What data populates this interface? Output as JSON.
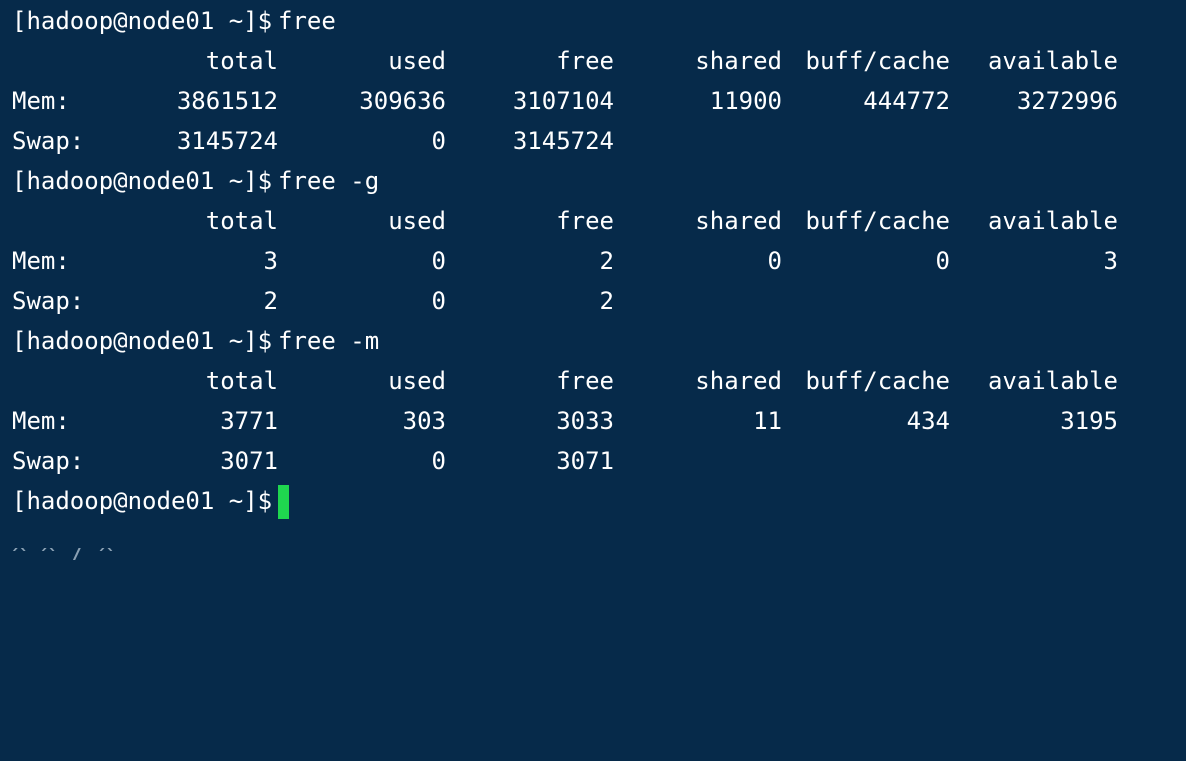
{
  "prompt": "[hadoop@node01 ~]$",
  "blocks": [
    {
      "command": "free",
      "headers": {
        "total": "total",
        "used": "used",
        "free": "free",
        "shared": "shared",
        "buff_cache": "buff/cache",
        "available": "available"
      },
      "rows": [
        {
          "label": "Mem:",
          "total": "3861512",
          "used": "309636",
          "free": "3107104",
          "shared": "11900",
          "buff_cache": "444772",
          "available": "3272996"
        },
        {
          "label": "Swap:",
          "total": "3145724",
          "used": "0",
          "free": "3145724"
        }
      ]
    },
    {
      "command": "free -g",
      "headers": {
        "total": "total",
        "used": "used",
        "free": "free",
        "shared": "shared",
        "buff_cache": "buff/cache",
        "available": "available"
      },
      "rows": [
        {
          "label": "Mem:",
          "total": "3",
          "used": "0",
          "free": "2",
          "shared": "0",
          "buff_cache": "0",
          "available": "3"
        },
        {
          "label": "Swap:",
          "total": "2",
          "used": "0",
          "free": "2"
        }
      ]
    },
    {
      "command": "free -m",
      "headers": {
        "total": "total",
        "used": "used",
        "free": "free",
        "shared": "shared",
        "buff_cache": "buff/cache",
        "available": "available"
      },
      "rows": [
        {
          "label": "Mem:",
          "total": "3771",
          "used": "303",
          "free": "3033",
          "shared": "11",
          "buff_cache": "434",
          "available": "3195"
        },
        {
          "label": "Swap:",
          "total": "3071",
          "used": "0",
          "free": "3071"
        }
      ]
    }
  ],
  "partial_next_line": "^ ^ / ^ )",
  "colors": {
    "background": "#062a4a",
    "text": "#ffffff",
    "cursor": "#1fd64f"
  }
}
